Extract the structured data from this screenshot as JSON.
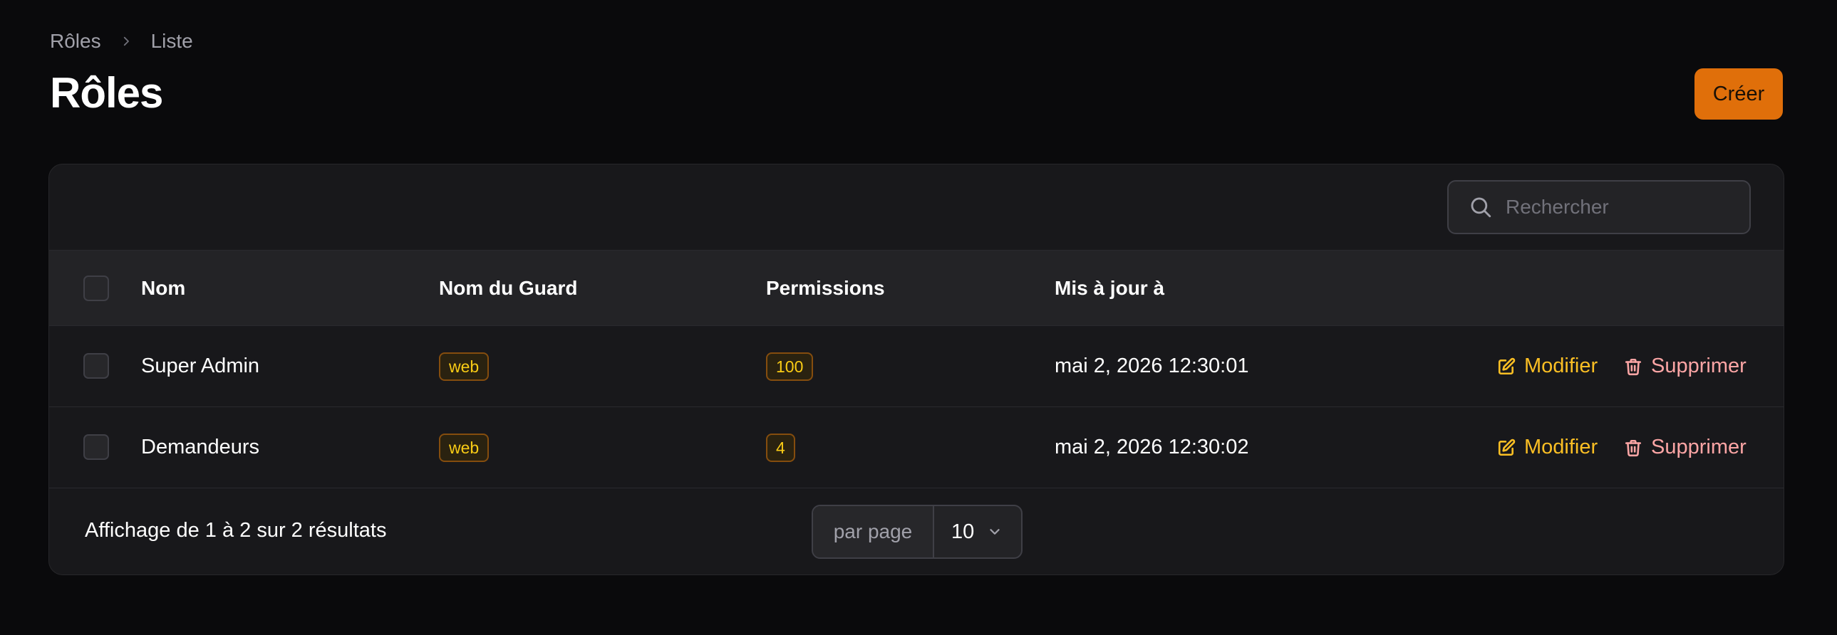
{
  "breadcrumb": {
    "items": [
      "Rôles",
      "Liste"
    ]
  },
  "page": {
    "title": "Rôles",
    "create_label": "Créer"
  },
  "search": {
    "placeholder": "Rechercher"
  },
  "table": {
    "columns": [
      "Nom",
      "Nom du Guard",
      "Permissions",
      "Mis à jour à"
    ],
    "rows": [
      {
        "name": "Super Admin",
        "guard": "web",
        "permissions": "100",
        "updated": "mai 2, 2026 12:30:01"
      },
      {
        "name": "Demandeurs",
        "guard": "web",
        "permissions": "4",
        "updated": "mai 2, 2026 12:30:02"
      }
    ],
    "actions": {
      "edit": "Modifier",
      "delete": "Supprimer"
    }
  },
  "footer": {
    "results_text": "Affichage de 1 à 2 sur 2 résultats",
    "per_page_label": "par page",
    "per_page_value": "10"
  },
  "colors": {
    "accent": "#e06f0a",
    "edit": "#fbbf24",
    "delete": "#fca5a5",
    "badge": "#facc15",
    "background": "#0a0a0c",
    "card": "#18181b"
  },
  "icons": [
    "chevron-right-icon",
    "search-icon",
    "edit-icon",
    "trash-icon",
    "chevron-down-icon"
  ]
}
